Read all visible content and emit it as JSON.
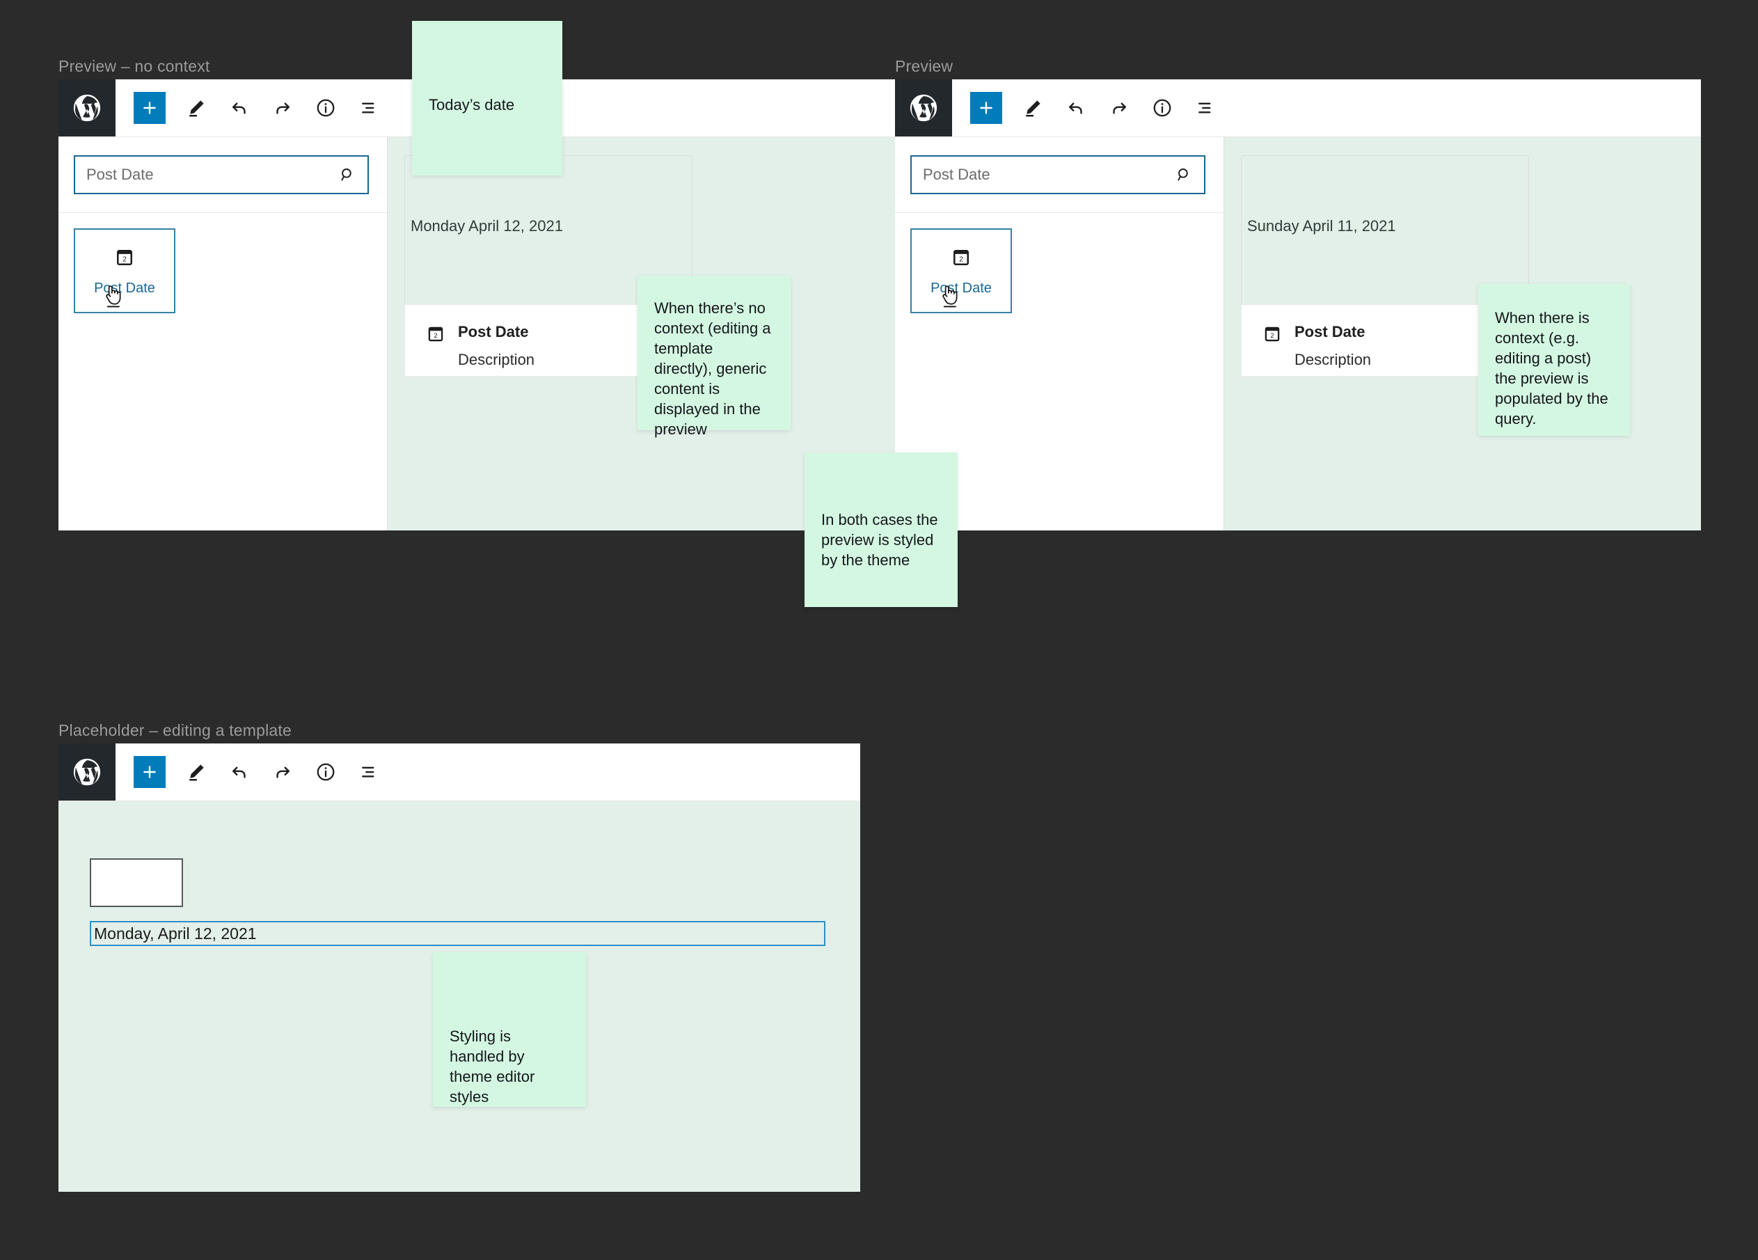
{
  "background_color": "#2b2b2b",
  "accent_color": "#007cba",
  "note_color": "#d4f7e2",
  "canvas_color": "#e3f0ea",
  "toolbar": {
    "logo_icon": "wordpress-logo-icon",
    "buttons": [
      {
        "name": "add-block-button",
        "icon": "plus-icon",
        "label": "+"
      },
      {
        "name": "edit-tool-button",
        "icon": "pencil-icon",
        "label": ""
      },
      {
        "name": "undo-button",
        "icon": "undo-arrow-icon",
        "label": ""
      },
      {
        "name": "redo-button",
        "icon": "redo-arrow-icon",
        "label": ""
      },
      {
        "name": "details-button",
        "icon": "info-circle-icon",
        "label": ""
      },
      {
        "name": "list-view-button",
        "icon": "list-view-icon",
        "label": ""
      }
    ]
  },
  "panels": [
    {
      "id": "preview-no-context",
      "title": "Preview – no context",
      "search": {
        "placeholder": "Post Date",
        "value": "",
        "icon": "search-icon"
      },
      "block_card": {
        "label": "Post Date",
        "icon": "calendar-icon",
        "icon_day": "2"
      },
      "preview": {
        "date": "Monday April 12, 2021",
        "block_title": "Post Date",
        "block_description": "Description",
        "block_icon": "calendar-icon",
        "block_icon_day": "2"
      }
    },
    {
      "id": "preview-with-context",
      "title": "Preview",
      "search": {
        "placeholder": "Post Date",
        "value": "",
        "icon": "search-icon"
      },
      "block_card": {
        "label": "Post Date",
        "icon": "calendar-icon",
        "icon_day": "2"
      },
      "preview": {
        "date": "Sunday April 11, 2021",
        "block_title": "Post Date",
        "block_description": "Description",
        "block_icon": "calendar-icon",
        "block_icon_day": "2"
      }
    }
  ],
  "placeholder_panel": {
    "id": "placeholder-editing-template",
    "title": "Placeholder – editing a template",
    "empty_box_label": "",
    "date_field_value": "Monday, April 12, 2021"
  },
  "notes": [
    {
      "id": "note-todays-date",
      "text": "Today’s date"
    },
    {
      "id": "note-no-context",
      "text": "When there’s no context (editing a template directly), generic content is displayed in the preview"
    },
    {
      "id": "note-with-context",
      "text": "When there is context (e.g. editing a post) the preview is populated by the query."
    },
    {
      "id": "note-both-cases",
      "text": "In both cases the preview is styled by the theme"
    },
    {
      "id": "note-theme-styles",
      "text": "Styling is handled by theme editor styles"
    }
  ]
}
